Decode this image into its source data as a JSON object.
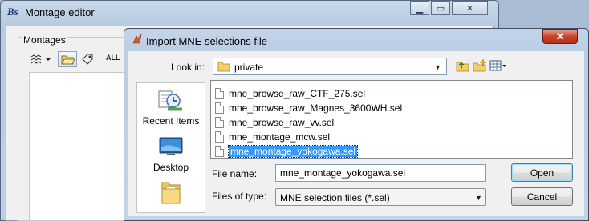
{
  "background_window": {
    "title": "Montage editor",
    "group_label": "Montages",
    "toolbar": {
      "all_label": "ALL"
    }
  },
  "dialog": {
    "title": "Import MNE selections file",
    "close_glyph": "✕",
    "look_in_label": "Look in:",
    "look_in_value": "private",
    "places": [
      {
        "label": "Recent Items",
        "icon": "recent-items-icon"
      },
      {
        "label": "Desktop",
        "icon": "desktop-icon"
      },
      {
        "label": "",
        "icon": "documents-icon"
      }
    ],
    "files": [
      {
        "name": "mne_browse_raw_CTF_275.sel",
        "selected": false
      },
      {
        "name": "mne_browse_raw_Magnes_3600WH.sel",
        "selected": false
      },
      {
        "name": "mne_browse_raw_vv.sel",
        "selected": false
      },
      {
        "name": "mne_montage_mcw.sel",
        "selected": false
      },
      {
        "name": "mne_montage_yokogawa.sel",
        "selected": true
      }
    ],
    "file_name_label": "File name:",
    "file_name_value": "mne_montage_yokogawa.sel",
    "files_of_type_label": "Files of type:",
    "files_of_type_value": "MNE selection files (*.sel)",
    "open_label": "Open",
    "cancel_label": "Cancel"
  },
  "colors": {
    "selection": "#3399ff",
    "title_bar": "#bfd2e8",
    "close_button": "#c9432b"
  }
}
